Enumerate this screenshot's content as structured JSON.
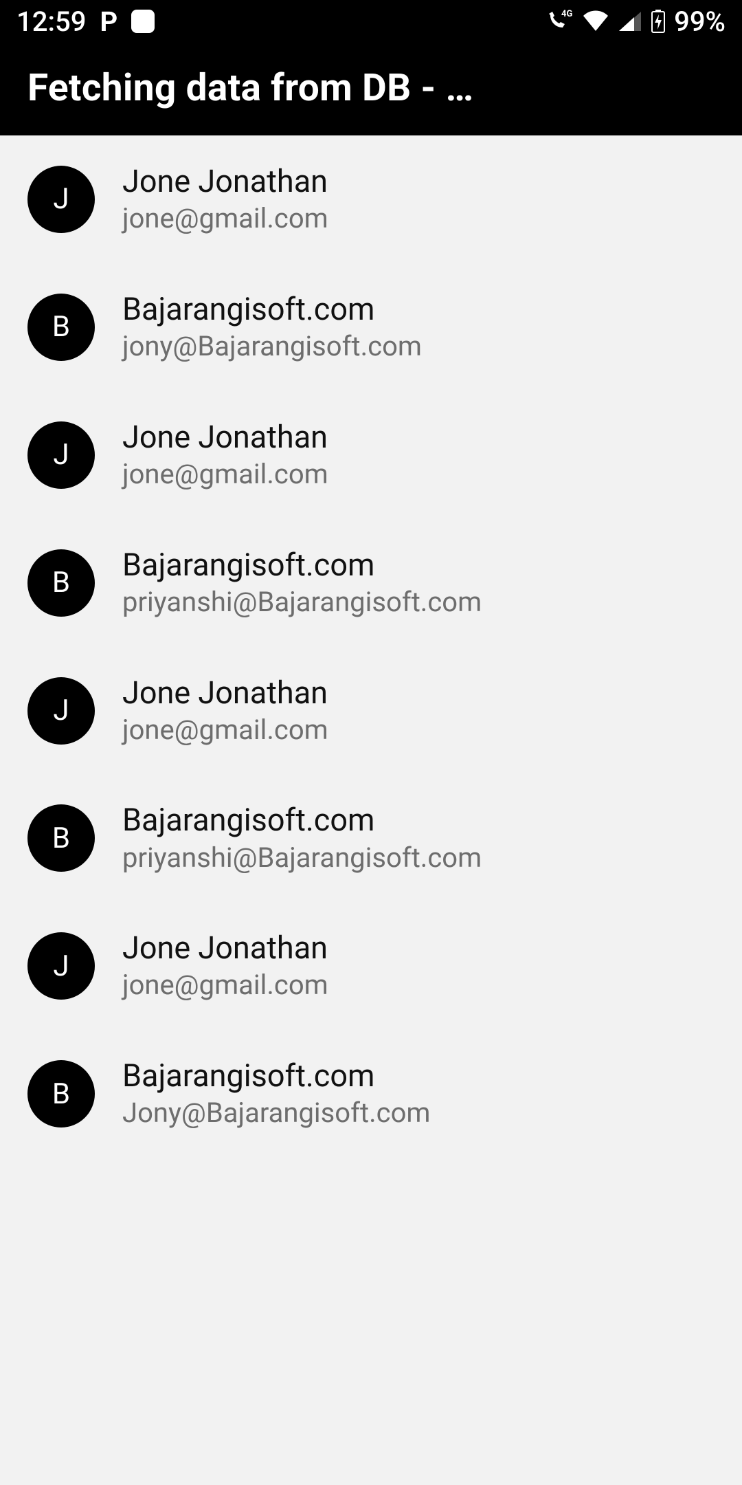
{
  "status_bar": {
    "time": "12:59",
    "battery_pct": "99%"
  },
  "app_bar": {
    "title": "Fetching data from DB - …"
  },
  "contacts": [
    {
      "initial": "J",
      "name": "Jone Jonathan",
      "email": "jone@gmail.com"
    },
    {
      "initial": "B",
      "name": "Bajarangisoft.com",
      "email": "jony@Bajarangisoft.com"
    },
    {
      "initial": "J",
      "name": "Jone Jonathan",
      "email": "jone@gmail.com"
    },
    {
      "initial": "B",
      "name": "Bajarangisoft.com",
      "email": "priyanshi@Bajarangisoft.com"
    },
    {
      "initial": "J",
      "name": "Jone Jonathan",
      "email": "jone@gmail.com"
    },
    {
      "initial": "B",
      "name": "Bajarangisoft.com",
      "email": "priyanshi@Bajarangisoft.com"
    },
    {
      "initial": "J",
      "name": "Jone Jonathan",
      "email": "jone@gmail.com"
    },
    {
      "initial": "B",
      "name": "Bajarangisoft.com",
      "email": "Jony@Bajarangisoft.com"
    }
  ]
}
